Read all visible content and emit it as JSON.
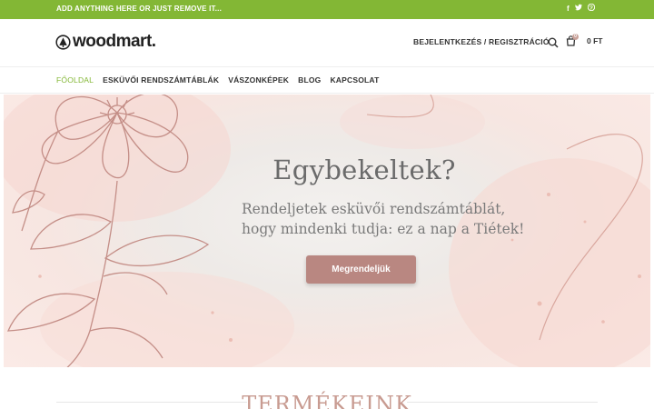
{
  "topbar": {
    "text": "ADD ANYTHING HERE OR JUST REMOVE IT...",
    "social": {
      "facebook": "f",
      "twitter": "t",
      "pinterest": "p"
    }
  },
  "header": {
    "logo_text": "woodmart.",
    "login_label": "BEJELENTKEZÉS / REGISZTRÁCIÓ",
    "cart_count": "0",
    "cart_total": "0 FT"
  },
  "nav": {
    "items": [
      {
        "label": "FŐOLDAL"
      },
      {
        "label": "ESKÜVŐI RENDSZÁMTÁBLÁK"
      },
      {
        "label": "VÁSZONKÉPEK"
      },
      {
        "label": "BLOG"
      },
      {
        "label": "KAPCSOLAT"
      }
    ]
  },
  "hero": {
    "title": "Egybekeltek?",
    "subtitle_line1": "Rendeljetek esküvői rendszámtáblát,",
    "subtitle_line2": "hogy mindenki tudja: ez a nap a Tiétek!",
    "button_label": "Megrendeljük"
  },
  "section": {
    "title": "TERMÉKEINK"
  },
  "colors": {
    "brand_green": "#83b735",
    "accent_rose": "#b98781",
    "title_rose": "#c89b91"
  }
}
